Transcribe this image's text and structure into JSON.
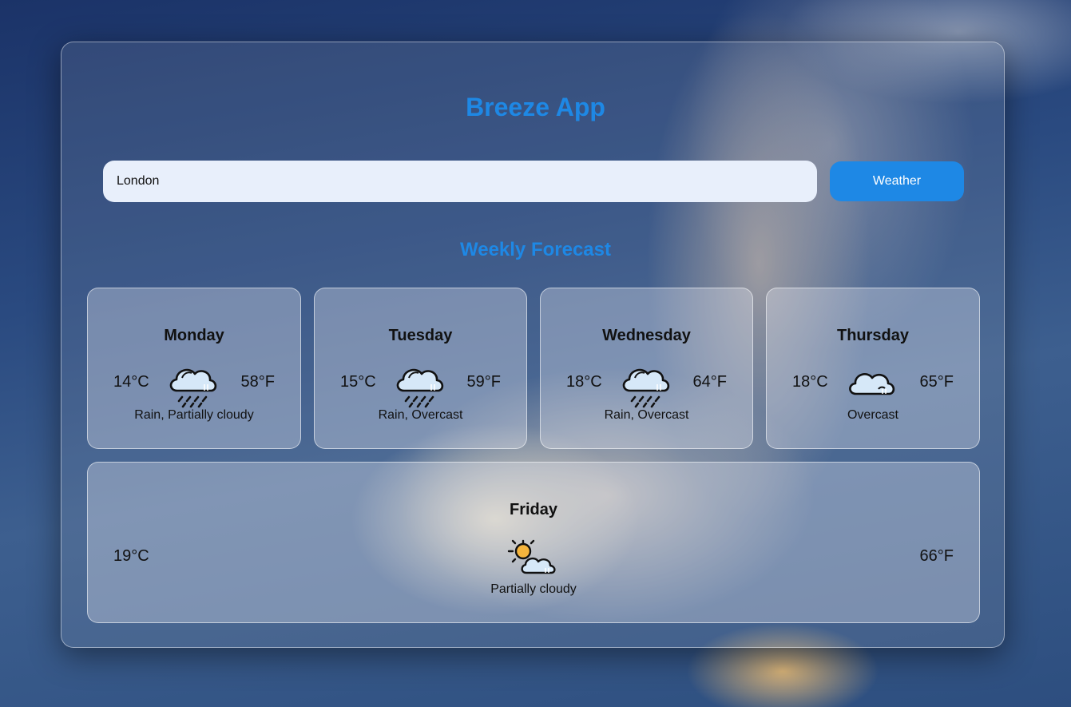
{
  "app": {
    "title": "Breeze App"
  },
  "search": {
    "value": "London",
    "button_label": "Weather"
  },
  "forecast": {
    "heading": "Weekly Forecast",
    "days": [
      {
        "day": "Monday",
        "temp_c": "14°C",
        "temp_f": "58°F",
        "condition": "Rain, Partially cloudy",
        "icon": "rain-cloud-icon"
      },
      {
        "day": "Tuesday",
        "temp_c": "15°C",
        "temp_f": "59°F",
        "condition": "Rain, Overcast",
        "icon": "rain-cloud-icon"
      },
      {
        "day": "Wednesday",
        "temp_c": "18°C",
        "temp_f": "64°F",
        "condition": "Rain, Overcast",
        "icon": "rain-cloud-icon"
      },
      {
        "day": "Thursday",
        "temp_c": "18°C",
        "temp_f": "65°F",
        "condition": "Overcast",
        "icon": "cloud-icon"
      },
      {
        "day": "Friday",
        "temp_c": "19°C",
        "temp_f": "66°F",
        "condition": "Partially cloudy",
        "icon": "sun-behind-cloud-icon"
      }
    ]
  },
  "colors": {
    "accent": "#1e88e5",
    "input_bg": "#e8effb",
    "cloud_fill": "#d6e8f8",
    "sun_fill": "#f5b53d"
  }
}
